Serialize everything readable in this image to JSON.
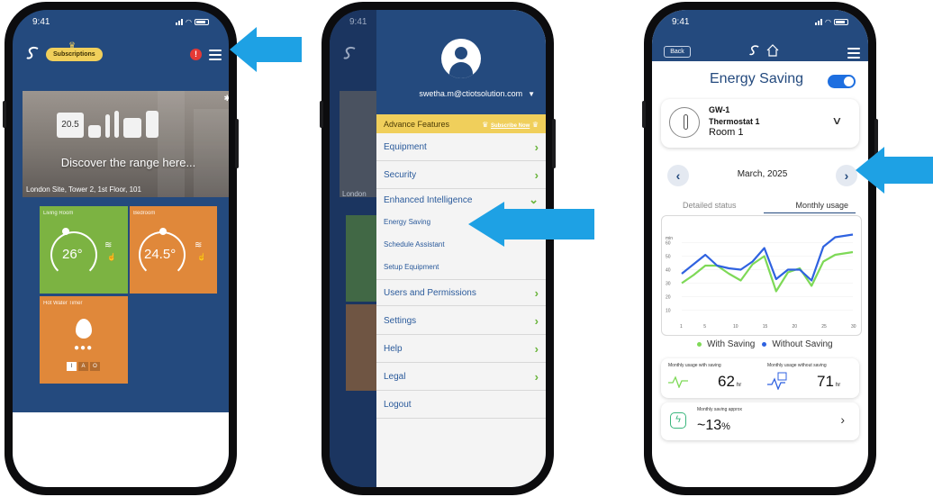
{
  "status_time": "9:41",
  "phone1": {
    "subscriptions_label": "Subscriptions",
    "alert_count": "!",
    "banner_title": "Discover the range here...",
    "banner_site": "London Site, Tower 2, 1st Floor, 101",
    "banner_device_temp": "20.5",
    "tiles": [
      {
        "name": "Living Room",
        "temp": "26°"
      },
      {
        "name": "Bedroom",
        "temp": "24.5°"
      },
      {
        "name": "Hot Water Timer",
        "switch": [
          "I",
          "A",
          "O"
        ]
      }
    ],
    "colors": {
      "header": "#244a7e",
      "tile_green": "#7cb342",
      "tile_orange": "#e0883a",
      "subs_pill": "#f0cf5b"
    }
  },
  "phone2": {
    "email": "swetha.m@ctiotsolution.com",
    "advance_features": "Advance Features",
    "subscribe_now": "Subscribe Now",
    "background_hint": "London",
    "menu": [
      {
        "label": "Equipment",
        "chevron": "›"
      },
      {
        "label": "Security",
        "chevron": "›"
      },
      {
        "label": "Enhanced Intelligence",
        "chevron": "⌄"
      },
      {
        "label": "Users and Permissions",
        "chevron": "›"
      },
      {
        "label": "Settings",
        "chevron": "›"
      },
      {
        "label": "Help",
        "chevron": "›"
      },
      {
        "label": "Legal",
        "chevron": "›"
      },
      {
        "label": "Logout",
        "chevron": ""
      }
    ],
    "submenu": [
      "Energy Saving",
      "Schedule Assistant",
      "Setup Equipment"
    ]
  },
  "phone3": {
    "back_label": "Back",
    "title": "Energy Saving",
    "toggle_on": true,
    "device": {
      "gateway": "GW-1",
      "name": "Thermostat  1",
      "room": "Room 1"
    },
    "month": "March, 2025",
    "tabs": [
      "Detailed status",
      "Monthly usage"
    ],
    "active_tab": "Monthly usage",
    "legend": [
      "With Saving",
      "Without Saving"
    ],
    "stats": [
      {
        "label": "Monthly usage with saving",
        "value": "62",
        "unit": "hr"
      },
      {
        "label": "Monthly usage without saving",
        "value": "71",
        "unit": "hr"
      }
    ],
    "saving": {
      "label": "Monthly saving approx",
      "value": "~13",
      "unit": "%"
    }
  },
  "chart_data": {
    "type": "line",
    "x": [
      1,
      3,
      5,
      7,
      9,
      11,
      13,
      15,
      17,
      19,
      21,
      23,
      25,
      27,
      30
    ],
    "xticks": [
      "1",
      "5",
      "10",
      "15",
      "20",
      "25",
      "30"
    ],
    "yticks": [
      "10",
      "20",
      "30",
      "40",
      "50",
      "60"
    ],
    "ylabel": "min",
    "ylim": [
      5,
      65
    ],
    "series": [
      {
        "name": "With Saving",
        "color": "#7ed957",
        "values": [
          30,
          36,
          43,
          43,
          37,
          32,
          44,
          50,
          24,
          38,
          41,
          28,
          46,
          51,
          53
        ]
      },
      {
        "name": "Without Saving",
        "color": "#2f62e0",
        "values": [
          37,
          44,
          51,
          43,
          41,
          40,
          46,
          56,
          33,
          40,
          40,
          32,
          57,
          64,
          66
        ]
      }
    ]
  },
  "arrow_color": "#1ea1e4"
}
